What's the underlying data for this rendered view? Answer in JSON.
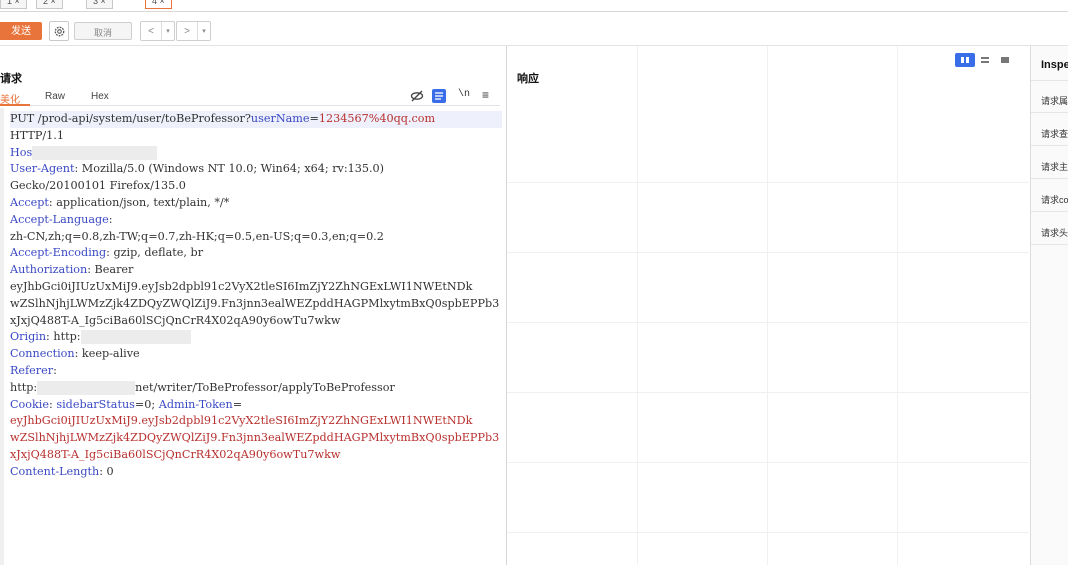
{
  "tabs": [
    "1 ×",
    "2 ×",
    "3 ×",
    "4 ×"
  ],
  "toolbar": {
    "send_label": "发送",
    "cancel_label": "取消",
    "back_label": "<",
    "forward_label": ">",
    "dropdown_label": "▾",
    "settings_icon": "gear-icon"
  },
  "request": {
    "title": "请求",
    "subtabs": [
      "美化",
      "Raw",
      "Hex"
    ],
    "tools": {
      "hide": "⊘",
      "wrap_label": "\\n",
      "menu": "≡"
    },
    "lines": [
      {
        "seg": [
          {
            "t": "PUT /prod-api/system/user/toBeProfessor?",
            "c": ""
          },
          {
            "t": "userName",
            "c": "k"
          },
          {
            "t": "=",
            "c": ""
          },
          {
            "t": "1234567%40qq.com",
            "c": "s"
          }
        ],
        "hl": true
      },
      {
        "seg": [
          {
            "t": "HTTP/1.1",
            "c": ""
          }
        ]
      },
      {
        "seg": [
          {
            "t": "Hos",
            "c": "k"
          }
        ],
        "mask": 125
      },
      {
        "seg": [
          {
            "t": "User-Agent",
            "c": "k"
          },
          {
            "t": ": Mozilla/5.0 (Windows NT 10.0; Win64; x64; rv:135.0)",
            "c": ""
          }
        ]
      },
      {
        "seg": [
          {
            "t": "Gecko/20100101 Firefox/135.0",
            "c": ""
          }
        ]
      },
      {
        "seg": [
          {
            "t": "Accept",
            "c": "k"
          },
          {
            "t": ": application/json, text/plain, */*",
            "c": ""
          }
        ]
      },
      {
        "seg": [
          {
            "t": "Accept-Language",
            "c": "k"
          },
          {
            "t": ":",
            "c": ""
          }
        ]
      },
      {
        "seg": [
          {
            "t": "zh-CN,zh;q=0.8,zh-TW;q=0.7,zh-HK;q=0.5,en-US;q=0.3,en;q=0.2",
            "c": ""
          }
        ]
      },
      {
        "seg": [
          {
            "t": "Accept-Encoding",
            "c": "k"
          },
          {
            "t": ": gzip, deflate, br",
            "c": ""
          }
        ]
      },
      {
        "seg": [
          {
            "t": "Authorization",
            "c": "k"
          },
          {
            "t": ": Bearer",
            "c": ""
          }
        ]
      },
      {
        "seg": [
          {
            "t": "eyJhbGci0iJIUzUxMiJ9.eyJsb2dpbl91c2VyX2tleSI6ImZjY2ZhNGExLWI1NWEtNDk",
            "c": ""
          }
        ]
      },
      {
        "seg": [
          {
            "t": "wZSlhNjhjLWMzZjk4ZDQyZWQlZiJ9.Fn3jnn3ealWEZpddHAGPMlxytmBxQ0spbEPPb3",
            "c": ""
          }
        ]
      },
      {
        "seg": [
          {
            "t": "xJxjQ488T-A_Ig5ciBa60lSCjQnCrR4X02qA90y6owTu7wkw",
            "c": ""
          }
        ]
      },
      {
        "seg": [
          {
            "t": "Origin",
            "c": "k"
          },
          {
            "t": ": http:",
            "c": ""
          }
        ],
        "mask": 110
      },
      {
        "seg": [
          {
            "t": "Connection",
            "c": "k"
          },
          {
            "t": ": keep-alive",
            "c": ""
          }
        ]
      },
      {
        "seg": [
          {
            "t": "Referer",
            "c": "k"
          },
          {
            "t": ":",
            "c": ""
          }
        ]
      },
      {
        "seg": [
          {
            "t": "http:",
            "c": ""
          }
        ],
        "mask": 98,
        "after": "net/writer/ToBeProfessor/applyToBeProfessor"
      },
      {
        "seg": [
          {
            "t": "Cookie",
            "c": "k"
          },
          {
            "t": ": ",
            "c": ""
          },
          {
            "t": "sidebarStatus",
            "c": "k"
          },
          {
            "t": "=0; ",
            "c": ""
          },
          {
            "t": "Admin-Token",
            "c": "k"
          },
          {
            "t": "=",
            "c": ""
          }
        ]
      },
      {
        "seg": [
          {
            "t": "eyJhbGci0iJIUzUxMiJ9.eyJsb2dpbl91c2VyX2tleSI6ImZjY2ZhNGExLWI1NWEtNDk",
            "c": "s"
          }
        ]
      },
      {
        "seg": [
          {
            "t": "wZSlhNjhjLWMzZjk4ZDQyZWQlZiJ9.Fn3jnn3ealWEZpddHAGPMlxytmBxQ0spbEPPb3",
            "c": "s"
          }
        ]
      },
      {
        "seg": [
          {
            "t": "xJxjQ488T-A_Ig5ciBa60lSCjQnCrR4X02qA90y6owTu7wkw",
            "c": "s"
          }
        ]
      },
      {
        "seg": [
          {
            "t": "Content-Length",
            "c": "k"
          },
          {
            "t": ": 0",
            "c": ""
          }
        ]
      }
    ]
  },
  "response": {
    "title": "响应"
  },
  "inspector": {
    "title": "Inspe",
    "items": [
      "请求属",
      "请求查",
      "请求主",
      "请求co",
      "请求头"
    ]
  },
  "colors": {
    "accent": "#e8743b",
    "key": "#3a49c4",
    "value": "#b8312f"
  }
}
